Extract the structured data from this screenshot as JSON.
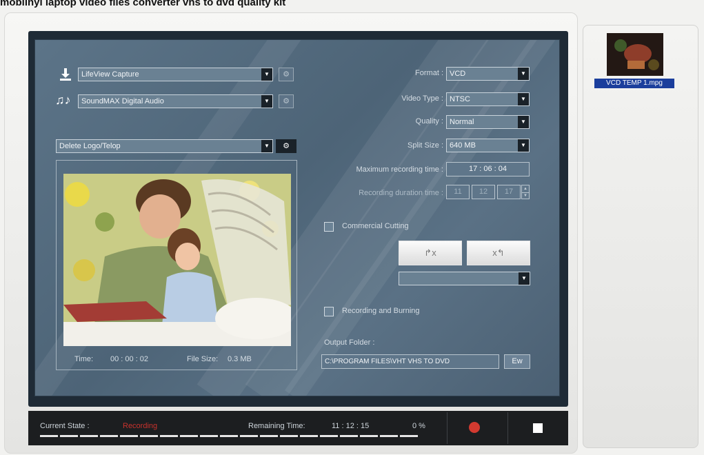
{
  "caption": "mobilnyi laptop video files converter vhs to dvd quality kit",
  "devices": {
    "video_device": "LifeView Capture",
    "audio_device": "SoundMAX Digital Audio"
  },
  "filter": {
    "selected": "Delete Logo/Telop"
  },
  "preview": {
    "time_label": "Time:",
    "time_value": "00 : 00 : 02",
    "size_label": "File Size:",
    "size_value": "0.3 MB"
  },
  "settings": {
    "format_label": "Format :",
    "format_value": "VCD",
    "video_type_label": "Video Type :",
    "video_type_value": "NTSC",
    "quality_label": "Quality :",
    "quality_value": "Normal",
    "split_label": "Split Size :",
    "split_value": "640 MB",
    "max_time_label": "Maximum recording time :",
    "max_time_value": "17 : 06 : 04",
    "duration_label": "Recording duration time :",
    "duration_h": "11",
    "duration_m": "12",
    "duration_s": "17",
    "commercial_label": "Commercial Cutting",
    "cut_in_icon": "↱x",
    "cut_out_icon": "x↰",
    "burn_label": "Recording and Burning",
    "output_label": "Output Folder :",
    "output_path": "C:\\PROGRAM FILES\\VHT VHS TO DVD",
    "browse_label": "Ew"
  },
  "status": {
    "state_label": "Current State :",
    "state_value": "Recording",
    "remaining_label": "Remaining Time:",
    "remaining_value": "11 : 12 : 15",
    "percent": "0 %",
    "progress": 0
  },
  "playlist": {
    "item_label": "VCD TEMP 1.mpg"
  },
  "colors": {
    "panel": "#566d81",
    "bezel": "#1f2b36",
    "state_red": "#c8322c",
    "record_red": "#d23a30",
    "selection_blue": "#1b3e9c"
  }
}
